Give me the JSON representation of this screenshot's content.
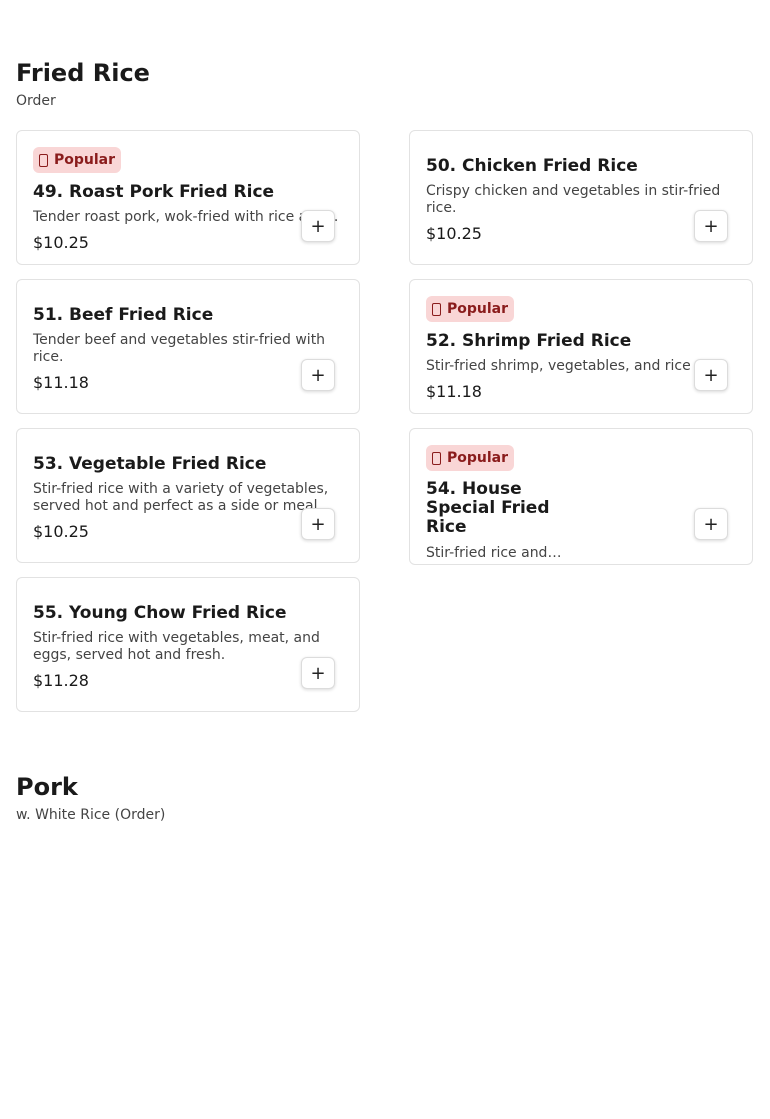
{
  "sections": [
    {
      "title": "Fried Rice",
      "subtitle": "Order"
    },
    {
      "title": "Pork",
      "subtitle": "w. White Rice (Order)"
    }
  ],
  "badge_label": "Popular",
  "badge_icon": "flame-icon",
  "add_label": "+",
  "items": [
    {
      "name": "49. Roast Pork Fried Rice",
      "desc": "Tender roast pork, wok-fried with rice and...",
      "price": "$10.25",
      "popular": true
    },
    {
      "name": "50. Chicken Fried Rice",
      "desc": "Crispy chicken and vegetables in stir-fried rice.",
      "price": "$10.25",
      "popular": false
    },
    {
      "name": "51. Beef Fried Rice",
      "desc": "Tender beef and vegetables stir-fried with rice.",
      "price": "$11.18",
      "popular": false
    },
    {
      "name": "52. Shrimp Fried Rice",
      "desc": "Stir-fried shrimp, vegetables, and rice",
      "price": "$11.18",
      "popular": true
    },
    {
      "name": "53. Vegetable Fried Rice",
      "desc": "Stir-fried rice with a variety of vegetables, served hot and perfect as a side or meal.",
      "price": "$10.25",
      "popular": false
    },
    {
      "name": "54. House Special Fried Rice",
      "desc": "Stir-fried rice and…",
      "price": "",
      "popular": true
    },
    {
      "name": "55. Young Chow Fried Rice",
      "desc": "Stir-fried rice with vegetables, meat, and eggs, served hot and fresh.",
      "price": "$11.28",
      "popular": false
    }
  ],
  "colors": {
    "badge_bg": "#f9d6d6",
    "badge_text": "#8a1c1c",
    "card_border": "#e2e2e2"
  }
}
